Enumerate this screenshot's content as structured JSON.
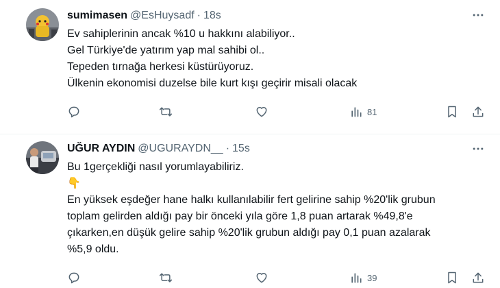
{
  "tweets": [
    {
      "name": "sumimasen",
      "handle": "@EsHuysadf",
      "separator": "·",
      "time": "18s",
      "lines": [
        "Ev sahiplerinin ancak %10 u hakkını alabiliyor..",
        "Gel Türkiye'de yatırım yap mal sahibi ol..",
        "Tepeden tırnağa herkesi küstürüyoruz.",
        "Ülkenin ekonomisi duzelse bile kurt kışı geçirir misali olacak"
      ],
      "views": "81"
    },
    {
      "name": "UĞUR AYDIN",
      "handle": "@UGURAYDN__",
      "separator": "·",
      "time": "15s",
      "lines": [
        "Bu 1gerçekliği nasıl yorumlayabiliriz.",
        "👇",
        "En yüksek eşdeğer hane halkı kullanılabilir fert gelirine sahip %20'lik grubun",
        "toplam gelirden aldığı pay bir önceki yıla göre 1,8 puan artarak %49,8'e",
        "çıkarken,en düşük gelire sahip %20'lik grubun aldığı pay 0,1 puan azalarak",
        "%5,9 oldu."
      ],
      "views": "39"
    }
  ],
  "icons": {
    "reply": "reply-icon",
    "retweet": "retweet-icon",
    "like": "heart-icon",
    "views": "views-chart-icon",
    "bookmark": "bookmark-icon",
    "share": "share-icon",
    "more": "more-dots-icon"
  },
  "colors": {
    "text": "#0f1419",
    "secondary": "#536471",
    "divider": "#eff3f4"
  }
}
